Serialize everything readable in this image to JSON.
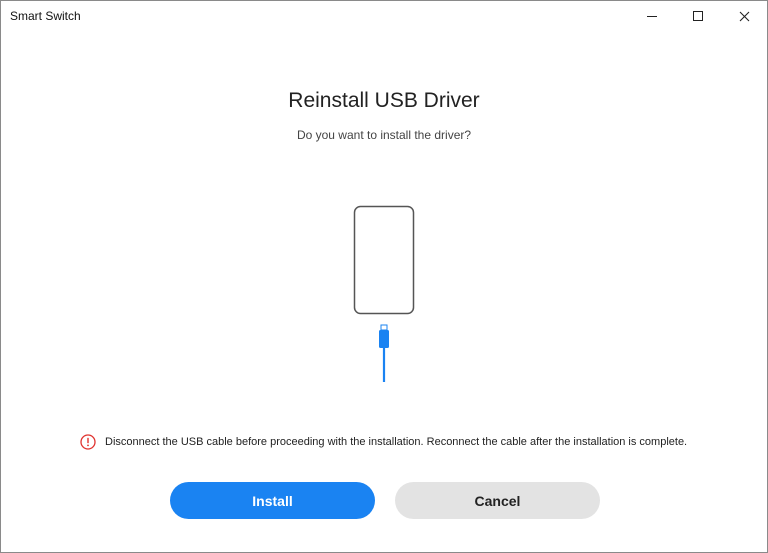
{
  "window": {
    "title": "Smart Switch"
  },
  "dialog": {
    "heading": "Reinstall USB Driver",
    "subheading": "Do you want to install the driver?",
    "warning": "Disconnect the USB cable before proceeding with the installation. Reconnect the cable after the installation is complete.",
    "install_label": "Install",
    "cancel_label": "Cancel"
  },
  "icons": {
    "phone": "phone-outline-icon",
    "usb_cable": "usb-cable-icon",
    "warning": "exclamation-circle-icon",
    "minimize": "minimize-icon",
    "maximize": "maximize-icon",
    "close": "close-icon"
  },
  "colors": {
    "accent": "#1a83f2",
    "warning": "#e0322e",
    "cancel_bg": "#e3e3e3",
    "phone_outline": "#555555"
  }
}
